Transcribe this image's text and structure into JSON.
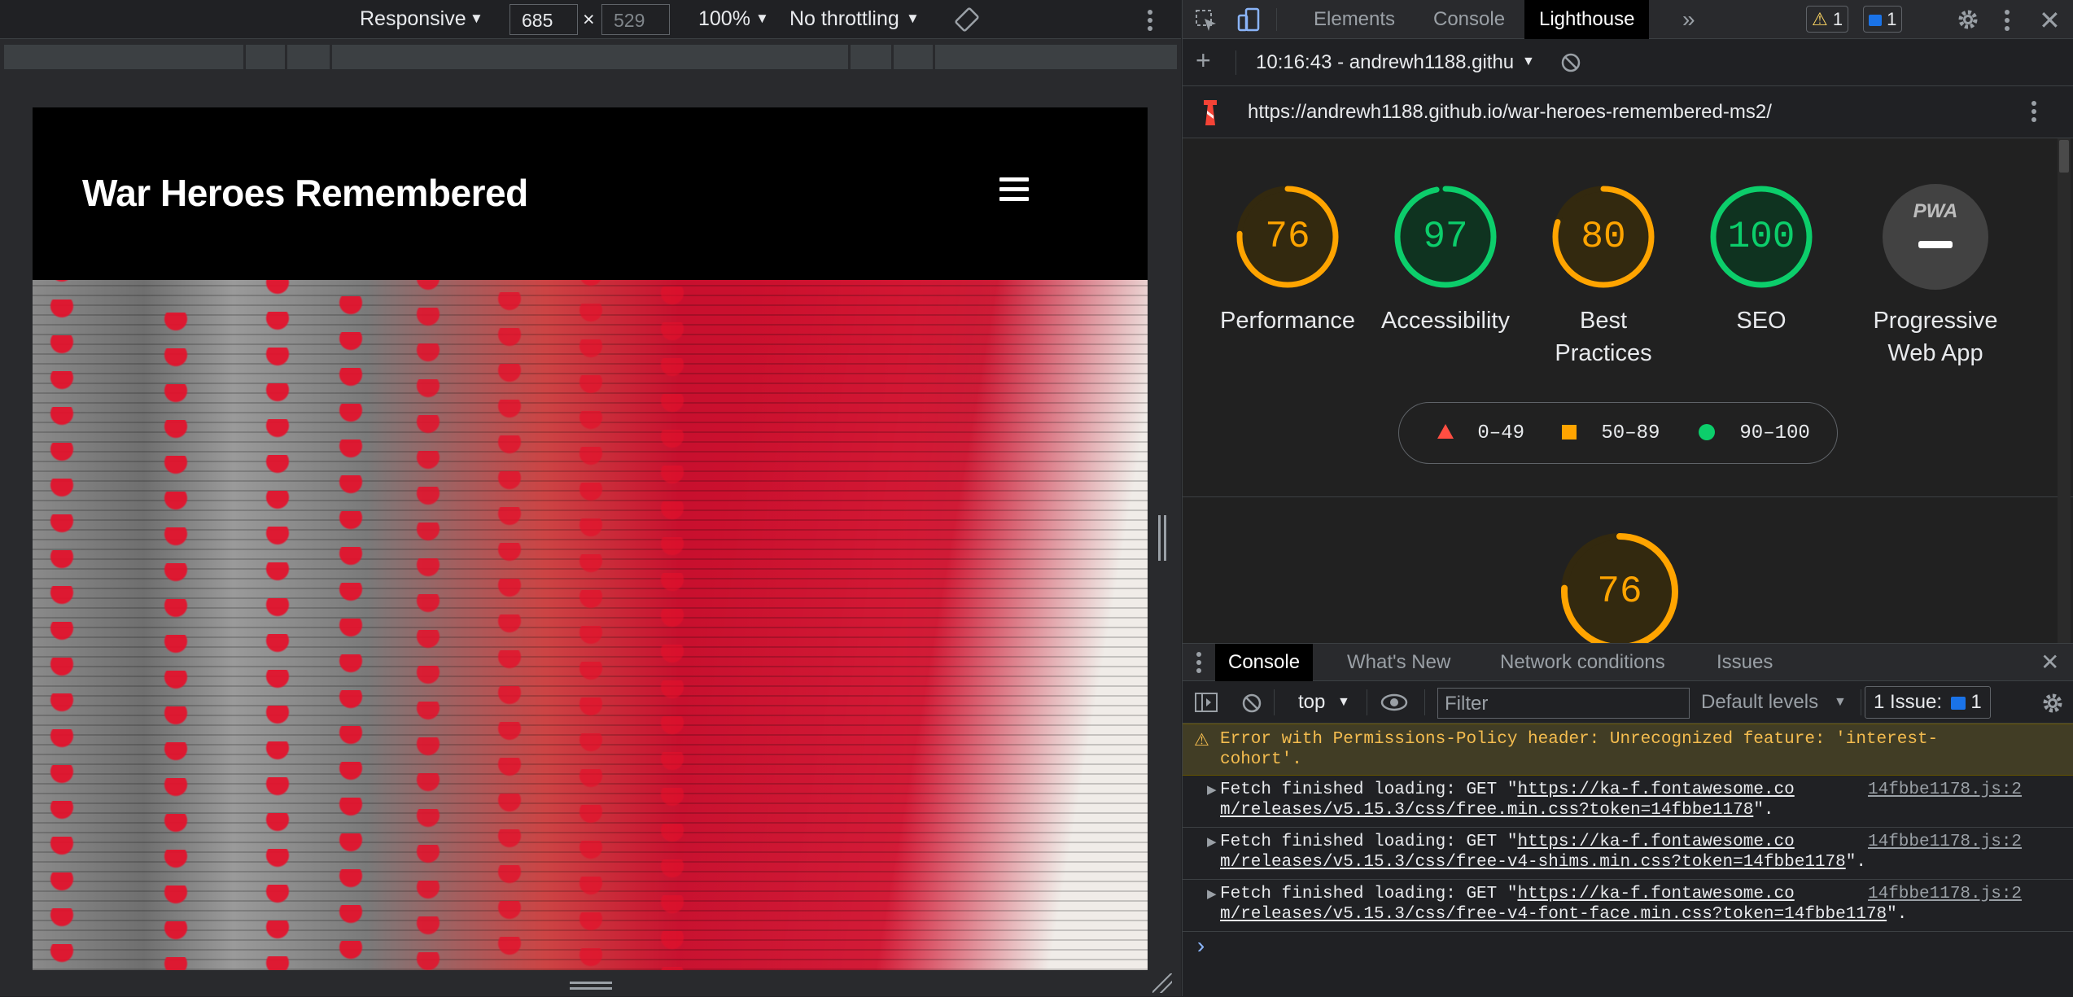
{
  "device_toolbar": {
    "device": "Responsive",
    "width": "685",
    "height": "529",
    "zoom": "100%",
    "throttling": "No throttling"
  },
  "site": {
    "title": "War Heroes Remembered"
  },
  "devtools": {
    "tabs": [
      "Elements",
      "Console",
      "Lighthouse"
    ],
    "active_tab": "Lighthouse",
    "more_tabs": "»",
    "warnings_count": "1",
    "issues_count": "1",
    "report_selector": "10:16:43 - andrewh1188.githu",
    "report_url": "https://andrewh1188.github.io/war-heroes-remembered-ms2/"
  },
  "lighthouse": {
    "scores": [
      {
        "label_line1": "Performance",
        "label_line2": "",
        "value": "76",
        "fraction": 0.76,
        "color": "#ffa400",
        "bg": "#33290f"
      },
      {
        "label_line1": "Accessibility",
        "label_line2": "",
        "value": "97",
        "fraction": 0.97,
        "color": "#0cce6b",
        "bg": "#0f3320"
      },
      {
        "label_line1": "Best",
        "label_line2": "Practices",
        "value": "80",
        "fraction": 0.8,
        "color": "#ffa400",
        "bg": "#33290f"
      },
      {
        "label_line1": "SEO",
        "label_line2": "",
        "value": "100",
        "fraction": 1.0,
        "color": "#0cce6b",
        "bg": "#0f3320"
      }
    ],
    "pwa": {
      "label_line1": "Progressive",
      "label_line2": "Web App",
      "badge": "PWA"
    },
    "legend": [
      {
        "range": "0–49",
        "color": "#ff4e42"
      },
      {
        "range": "50–89",
        "color": "#ffa400"
      },
      {
        "range": "90–100",
        "color": "#0cce6b"
      }
    ],
    "detail_score": {
      "value": "76",
      "fraction": 0.76,
      "color": "#ffa400"
    }
  },
  "drawer": {
    "tabs": [
      "Console",
      "What's New",
      "Network conditions",
      "Issues"
    ],
    "active_tab": "Console",
    "context": "top",
    "filter_placeholder": "Filter",
    "levels": "Default levels",
    "issues_badge_label": "1 Issue:",
    "issues_badge_count": "1"
  },
  "console": {
    "warning_line1": "Error with Permissions-Policy header: Unrecognized feature: 'interest-",
    "warning_line2": "cohort'.",
    "messages": [
      {
        "prefix": "Fetch finished loading: GET \"",
        "url_part1": "https://ka-f.fontawesome.co",
        "url_part2": "m/releases/v5.15.3/css/free.min.css?token=14fbbe1178",
        "suffix": "\".",
        "source": "14fbbe1178.js:2"
      },
      {
        "prefix": "Fetch finished loading: GET \"",
        "url_part1": "https://ka-f.fontawesome.co",
        "url_part2": "m/releases/v5.15.3/css/free-v4-shims.min.css?token=14fbbe1178",
        "suffix": "\".",
        "source": "14fbbe1178.js:2"
      },
      {
        "prefix": "Fetch finished loading: GET \"",
        "url_part1": "https://ka-f.fontawesome.co",
        "url_part2": "m/releases/v5.15.3/css/free-v4-font-face.min.css?token=14fbbe1178",
        "suffix": "\".",
        "source": "14fbbe1178.js:2"
      }
    ],
    "prompt": "›"
  }
}
